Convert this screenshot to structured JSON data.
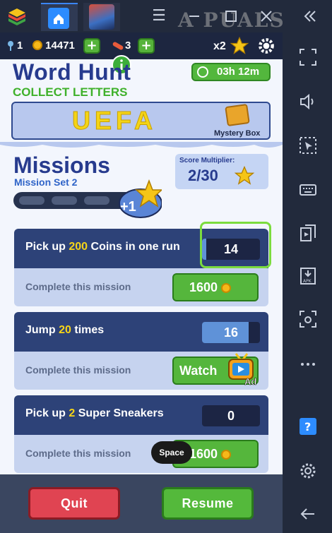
{
  "window": {
    "watermark": "A  PUALS",
    "controls": [
      "menu-icon",
      "minimize-icon",
      "maximize-icon",
      "close-icon",
      "collapse-icon"
    ]
  },
  "hud": {
    "keys": "1",
    "coins": "14471",
    "boards": "3",
    "multiplier": "x2"
  },
  "event": {
    "title": "Word Hunt",
    "subtitle": "COLLECT LETTERS",
    "timer": "03h 12m",
    "word": "UEFA",
    "reward_label": "Mystery Box"
  },
  "missions": {
    "title": "Missions",
    "set_label": "Mission Set 2",
    "bonus": "+1",
    "score_multiplier_label": "Score Multiplier:",
    "score_multiplier_value": "2/30",
    "items": [
      {
        "prefix": "Pick up ",
        "highlight": "200",
        "suffix": " Coins in one run",
        "count": "14",
        "progress": 0.07,
        "complete_label": "Complete this mission",
        "button": "1600"
      },
      {
        "prefix": "Jump ",
        "highlight": "20",
        "suffix": " times",
        "count": "16",
        "progress": 0.8,
        "complete_label": "Complete this mission",
        "button": "Watch",
        "button_badge": "Ad"
      },
      {
        "prefix": "Pick up ",
        "highlight": "2",
        "suffix": " Super Sneakers",
        "count": "0",
        "progress": 0,
        "complete_label": "Complete this mission",
        "button": "1600"
      }
    ]
  },
  "overlay": {
    "space_hint": "Space"
  },
  "actions": {
    "quit": "Quit",
    "resume": "Resume"
  },
  "sidebar_icons": [
    "fullscreen-icon",
    "volume-icon",
    "select-icon",
    "keyboard-icon",
    "screenshot-icon",
    "apk-icon",
    "camera-icon",
    "more-icon",
    "help-icon",
    "settings-icon",
    "back-icon"
  ],
  "colors": {
    "title_blue": "#273b8e",
    "green": "#55b63c",
    "red": "#e04452",
    "gold": "#f6d519",
    "highlight_green": "#7bdc3e"
  }
}
